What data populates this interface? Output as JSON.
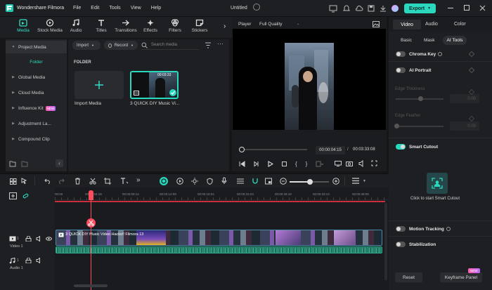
{
  "app": {
    "name": "Wondershare Filmora",
    "project": "Untitled",
    "export_label": "Export"
  },
  "menu": [
    "File",
    "Edit",
    "Tools",
    "View",
    "Help"
  ],
  "toolbar": [
    "Media",
    "Stock Media",
    "Audio",
    "Titles",
    "Transitions",
    "Effects",
    "Filters",
    "Stickers"
  ],
  "sidebar": {
    "items": [
      "Project Media",
      "Folder",
      "Global Media",
      "Cloud Media",
      "Influence Kit",
      "Adjustment La...",
      "Compound Clip"
    ],
    "new_badge": "NEW"
  },
  "media": {
    "import_label": "Import",
    "record_label": "Record",
    "search_placeholder": "Search media",
    "folder_label": "FOLDER",
    "import_media_label": "Import Media",
    "clip_name": "3 QUICK DIY Music Vi...",
    "clip_duration": "00:03:33"
  },
  "player": {
    "label": "Player",
    "quality": "Full Quality",
    "current": "00:00:04:15",
    "total": "00:03:33:08"
  },
  "right": {
    "tabs": [
      "Video",
      "Audio",
      "Color"
    ],
    "subtabs": [
      "Basic",
      "Mask",
      "AI Tools"
    ],
    "chroma": "Chroma Key",
    "ai_portrait": "AI Portrait",
    "edge_thickness": "Edge Thickness",
    "edge_feather": "Edge Feather",
    "zero1": "0.00",
    "zero2": "0.00",
    "smart_cutout": "Smart Cutout",
    "cutout_hint": "Click to start Smart Cutout",
    "motion": "Motion Tracking",
    "stabilization": "Stabilization",
    "reset": "Reset",
    "keyframe": "Keyframe Panel",
    "new_badge": "NEW"
  },
  "timeline": {
    "ticks": [
      "00:00",
      "00:00:04:19",
      "00:00:09:14",
      "00:00:14:09",
      "00:00:19:04",
      "00:00:23:23",
      "00:00:28:18",
      "00:00:33:13",
      "00:00:38:08"
    ],
    "video_track": "Video 1",
    "audio_track": "Audio 1",
    "clip_title": "3 QUICK DIY Music Video Hacks!! Filmora 13"
  },
  "colors": {
    "accent": "#2ad8bd",
    "playhead": "#ff4d5e",
    "video_clip": "#2b5c74",
    "audio_clip": "#1f6e5c"
  }
}
